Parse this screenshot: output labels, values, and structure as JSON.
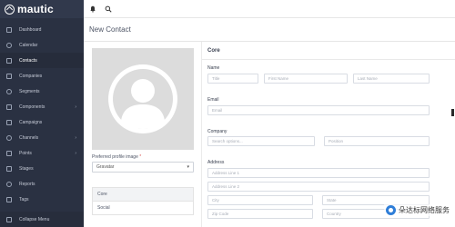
{
  "brand": {
    "name": "mautic"
  },
  "sidebar": {
    "items": [
      {
        "label": "Dashboard",
        "icon": "dashboard-icon",
        "arrow": ""
      },
      {
        "label": "Calendar",
        "icon": "calendar-icon",
        "arrow": ""
      },
      {
        "label": "Contacts",
        "icon": "contacts-icon",
        "arrow": ""
      },
      {
        "label": "Companies",
        "icon": "companies-icon",
        "arrow": ""
      },
      {
        "label": "Segments",
        "icon": "segments-icon",
        "arrow": ""
      },
      {
        "label": "Components",
        "icon": "components-icon",
        "arrow": "›"
      },
      {
        "label": "Campaigns",
        "icon": "campaigns-icon",
        "arrow": ""
      },
      {
        "label": "Channels",
        "icon": "channels-icon",
        "arrow": "›"
      },
      {
        "label": "Points",
        "icon": "points-icon",
        "arrow": "›"
      },
      {
        "label": "Stages",
        "icon": "stages-icon",
        "arrow": ""
      },
      {
        "label": "Reports",
        "icon": "reports-icon",
        "arrow": ""
      },
      {
        "label": "Tags",
        "icon": "tags-icon",
        "arrow": ""
      }
    ],
    "active_index": 2,
    "collapse_label": "Collapse Menu"
  },
  "page": {
    "title": "New Contact"
  },
  "left": {
    "preferred_image_label": "Preferred profile image",
    "required_mark": "*",
    "preferred_image_value": "Gravatar",
    "tabs": [
      "Core",
      "Social"
    ]
  },
  "form": {
    "section_title": "Core",
    "name_label": "Name",
    "title_placeholder": "Title",
    "first_name_placeholder": "First Name",
    "last_name_placeholder": "Last Name",
    "email_label": "Email",
    "email_placeholder": "Email",
    "company_label": "Company",
    "company_placeholder": "Search options...",
    "position_placeholder": "Position",
    "address_label": "Address",
    "address1_placeholder": "Address Line 1",
    "address2_placeholder": "Address Line 2",
    "city_placeholder": "City",
    "state_placeholder": "State",
    "zip_placeholder": "Zip Code",
    "country_placeholder": "Country"
  },
  "watermark": {
    "text": "朵达标网络服务"
  },
  "colors": {
    "sidebar_bg": "#2a3142",
    "accent": "#4e5e9e",
    "required": "#d9534f"
  }
}
